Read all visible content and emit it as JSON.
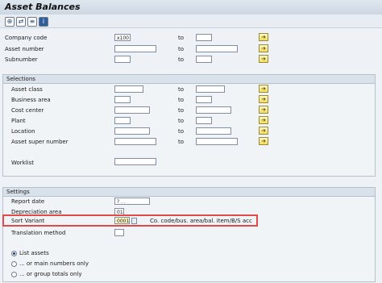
{
  "window": {
    "title": "Asset Balances"
  },
  "toolbar": {
    "icons": [
      "execute-icon",
      "get-variant-icon",
      "selection-options-icon",
      "info-icon"
    ]
  },
  "top": {
    "company_code": {
      "label": "Company code",
      "value": "x100",
      "to": "to"
    },
    "asset_number": {
      "label": "Asset number",
      "value": "",
      "to": "to"
    },
    "subnumber": {
      "label": "Subnumber",
      "value": "",
      "to": "to"
    }
  },
  "selections": {
    "header": "Selections",
    "asset_class": {
      "label": "Asset class",
      "to": "to"
    },
    "business_area": {
      "label": "Business area",
      "to": "to"
    },
    "cost_center": {
      "label": "Cost center",
      "to": "to"
    },
    "plant": {
      "label": "Plant",
      "to": "to"
    },
    "location": {
      "label": "Location",
      "to": "to"
    },
    "asset_super_number": {
      "label": "Asset super number",
      "to": "to"
    },
    "worklist": {
      "label": "Worklist"
    }
  },
  "settings": {
    "header": "Settings",
    "report_date": {
      "label": "Report date",
      "value": "? . ."
    },
    "depreciation_area": {
      "label": "Depreciation area",
      "value": "01"
    },
    "sort_variant": {
      "label": "Sort Variant",
      "value": "0001",
      "desc": "Co. code/bus. area/bal. item/B/S acc"
    },
    "translation_method": {
      "label": "Translation method",
      "value": ""
    },
    "radios": [
      {
        "label": "List assets",
        "selected": true
      },
      {
        "label": "... or main numbers only",
        "selected": false
      },
      {
        "label": "... or group totals only",
        "selected": false
      }
    ]
  }
}
